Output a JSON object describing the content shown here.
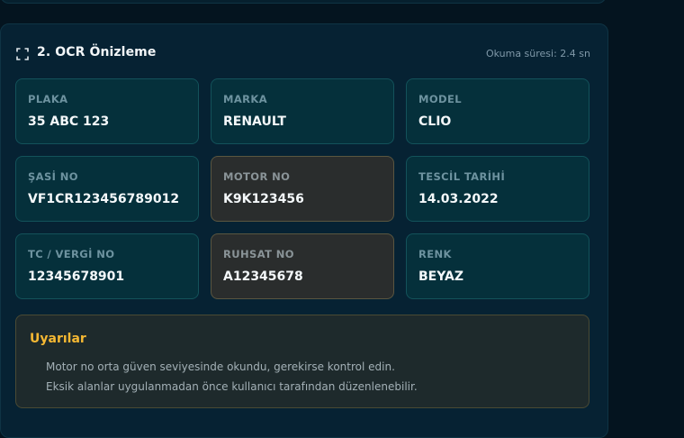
{
  "header": {
    "icon": "scan-frame-icon",
    "title": "2. OCR Önizleme",
    "read_time": "Okuma süresi: 2.4 sn"
  },
  "fields": [
    {
      "label": "PLAKA",
      "value": "35 ABC 123",
      "status": "ok"
    },
    {
      "label": "MARKA",
      "value": "RENAULT",
      "status": "ok"
    },
    {
      "label": "MODEL",
      "value": "CLIO",
      "status": "ok"
    },
    {
      "label": "ŞASİ NO",
      "value": "VF1CR123456789012",
      "status": "ok"
    },
    {
      "label": "MOTOR NO",
      "value": "K9K123456",
      "status": "warning"
    },
    {
      "label": "TESCİL TARİHİ",
      "value": "14.03.2022",
      "status": "ok"
    },
    {
      "label": "TC / VERGİ NO",
      "value": "12345678901",
      "status": "ok"
    },
    {
      "label": "RUHSAT NO",
      "value": "A12345678",
      "status": "warning"
    },
    {
      "label": "RENK",
      "value": "BEYAZ",
      "status": "ok"
    }
  ],
  "warnings": {
    "title": "Uyarılar",
    "items": [
      "Motor no orta güven seviyesinde okundu, gerekirse kontrol edin.",
      "Eksik alanlar uygulanmadan önce kullanıcı tarafından düzenlenebilir."
    ]
  },
  "colors": {
    "accent_warning": "#f5b833",
    "field_ok_bg": "#05303b",
    "field_warning_bg": "#2a2d2d"
  }
}
